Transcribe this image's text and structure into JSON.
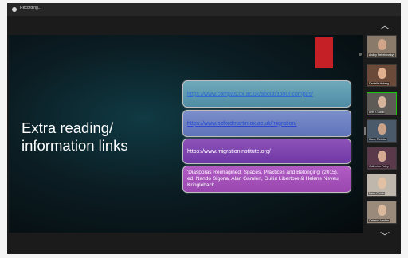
{
  "topbar": {
    "recording_label": "Recording..."
  },
  "slide": {
    "title": "Extra reading/\ninformation links",
    "links": [
      "https://www.compas.ox.ac.uk/about/about-compas/",
      "https://www.oxfordmartin.ox.ac.uk/migration/",
      "https://www.migrationinstitute.org/",
      "'Diasporas Reimagined. Spaces, Practices and Belonging' (2015), ed. Nando Sigona, Alan Gamlen, Guilia Libertore & Helene Neveu Kringlebach"
    ],
    "toolbar_icons": "⊖↗⊞⊙⊖"
  },
  "participants": [
    {
      "name": "Andriy Netrebovskyy",
      "bg": "#8a7a6a",
      "face": "#d1a58a"
    },
    {
      "name": "Danielle Hyberg",
      "bg": "#6b4a3a",
      "face": "#e0b08e"
    },
    {
      "name": "Ann K David",
      "bg": "#5e5a56",
      "face": "#d6b49c"
    },
    {
      "name": "Kuna, Rebeka",
      "bg": "#4a5a6a",
      "face": "#c9a28a"
    },
    {
      "name": "Catherine Foley",
      "bg": "#5a3a4a",
      "face": "#d4aa92"
    },
    {
      "name": "Nena Couch",
      "bg": "#bfb7ac",
      "face": "#e2c0a4"
    },
    {
      "name": "Caterina Vesfan",
      "bg": "#9a8a7c",
      "face": "#dbb99c"
    }
  ],
  "active_speaker_index": 2,
  "icons": {
    "scroll_up": "chevron-up-icon",
    "scroll_down": "chevron-down-icon",
    "recording": "recording-dot-icon"
  }
}
